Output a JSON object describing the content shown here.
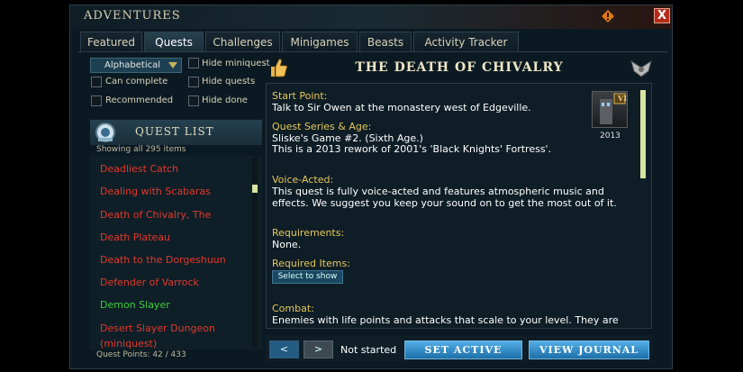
{
  "window": {
    "title": "ADVENTURES",
    "close_label": "X"
  },
  "tabs": [
    {
      "label": "Featured",
      "active": false
    },
    {
      "label": "Quests",
      "active": true
    },
    {
      "label": "Challenges",
      "active": false
    },
    {
      "label": "Minigames",
      "active": false
    },
    {
      "label": "Beasts",
      "active": false
    },
    {
      "label": "Activity Tracker",
      "active": false
    }
  ],
  "filters": {
    "sort_value": "Alphabetical",
    "hide_miniquest": "Hide miniquest",
    "can_complete": "Can complete",
    "hide_quests": "Hide quests",
    "recommended": "Recommended",
    "hide_done": "Hide done"
  },
  "quest_list": {
    "title": "QUEST LIST",
    "showing": "Showing all 295 items",
    "items": [
      {
        "name": "Deadliest Catch",
        "status": "not-started"
      },
      {
        "name": "Dealing with Scabaras",
        "status": "not-started"
      },
      {
        "name": "Death of Chivalry, The",
        "status": "not-started"
      },
      {
        "name": "Death Plateau",
        "status": "not-started"
      },
      {
        "name": "Death to the Dorgeshuun",
        "status": "not-started"
      },
      {
        "name": "Defender of Varrock",
        "status": "not-started"
      },
      {
        "name": "Demon Slayer",
        "status": "completed"
      },
      {
        "name": "Desert Slayer Dungeon",
        "status": "not-started"
      },
      {
        "name": "(miniquest)",
        "status": "not-started"
      }
    ],
    "quest_points": "Quest Points: 42 / 433"
  },
  "detail": {
    "title": "THE DEATH OF CHIVALRY",
    "start_point_label": "Start Point:",
    "start_point": "Talk to Sir Owen at the monastery west of Edgeville.",
    "series_label": "Quest Series & Age:",
    "series_line1": "Sliske's Game #2. (Sixth Age.)",
    "series_line2": "This is a 2013 rework of 2001's 'Black Knights' Fortress'.",
    "voice_label": "Voice-Acted:",
    "voice_line1": "This quest is fully voice-acted and features atmospheric music and",
    "voice_line2": "effects. We suggest you keep your sound on to get the most out of it.",
    "requirements_label": "Requirements:",
    "requirements": "None.",
    "items_label": "Required Items:",
    "select_show": "Select to show",
    "combat_label": "Combat:",
    "combat_line1": "Enemies with life points and attacks that scale to your level. They are",
    "poster_badge": "VI",
    "poster_year": "2013"
  },
  "footer": {
    "prev": "<",
    "next": ">",
    "status": "Not started",
    "set_active": "SET ACTIVE",
    "view_journal": "VIEW JOURNAL"
  },
  "colors": {
    "not_started": "#e2382a",
    "completed": "#3fcf3a",
    "label": "#e6c85a"
  }
}
